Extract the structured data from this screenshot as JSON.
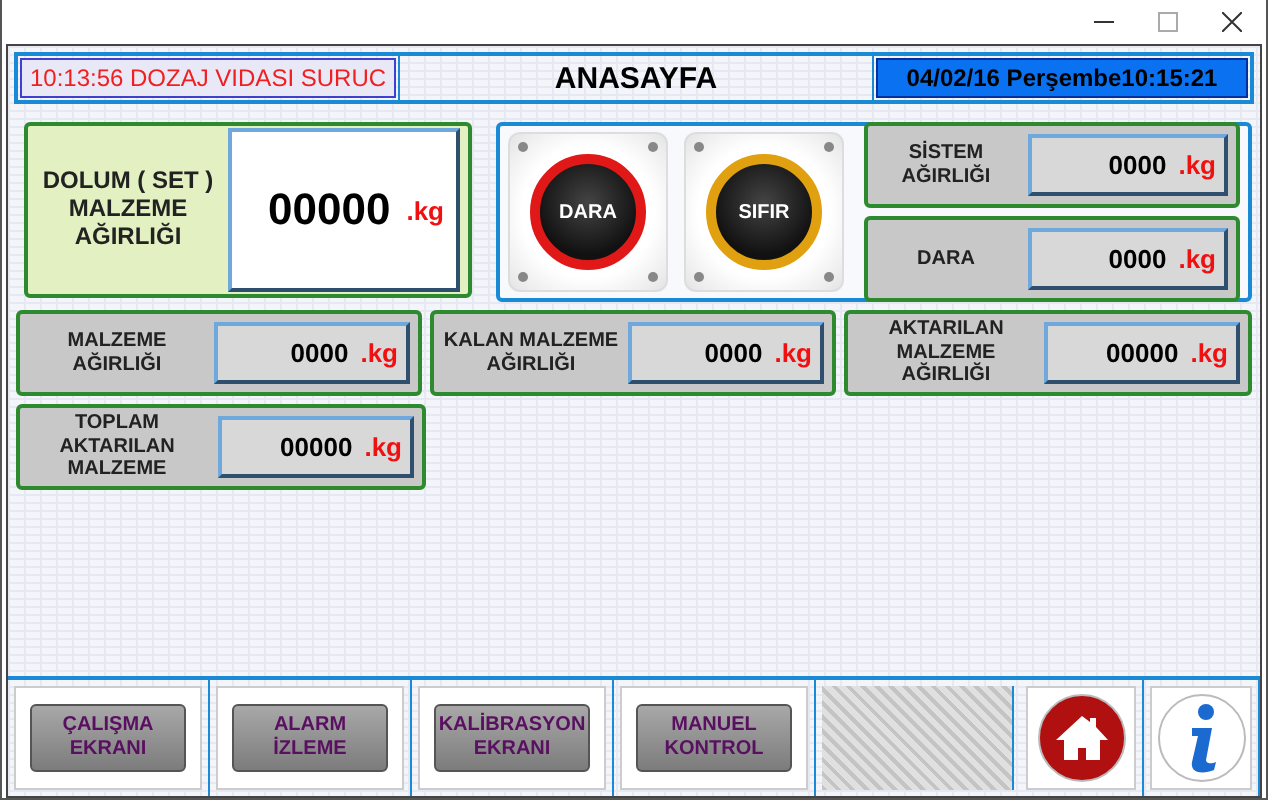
{
  "header": {
    "status_text": "10:13:56  DOZAJ VIDASI SURUC",
    "title": "ANASAYFA",
    "datetime": "04/02/16 Perşembe10:15:21"
  },
  "set_panel": {
    "label": "DOLUM ( SET )\nMALZEME\nAĞIRLIĞI",
    "value": "00000",
    "unit": ".kg"
  },
  "round_buttons": [
    {
      "label": "DARA",
      "kind": "red"
    },
    {
      "label": "SIFIR",
      "kind": "yellow"
    }
  ],
  "side_readings": [
    {
      "label": "SİSTEM\nAĞIRLIĞI",
      "value": "0000",
      "unit": ".kg"
    },
    {
      "label": "DARA",
      "value": "0000",
      "unit": ".kg"
    }
  ],
  "readings": [
    {
      "label": "MALZEME\nAĞIRLIĞI",
      "value": "0000",
      "unit": ".kg"
    },
    {
      "label": "KALAN MALZEME\nAĞIRLIĞI",
      "value": "0000",
      "unit": ".kg"
    },
    {
      "label": "AKTARILAN\nMALZEME\nAĞIRLIĞI",
      "value": "00000",
      "unit": ".kg"
    },
    {
      "label": "TOPLAM\nAKTARILAN\nMALZEME",
      "value": "00000",
      "unit": ".kg"
    }
  ],
  "nav_buttons": [
    {
      "label": "ÇALIŞMA\nEKRANI"
    },
    {
      "label": "ALARM\nİZLEME"
    },
    {
      "label": "KALİBRASYON\nEKRANI"
    },
    {
      "label": "MANUEL\nKONTROL"
    }
  ]
}
